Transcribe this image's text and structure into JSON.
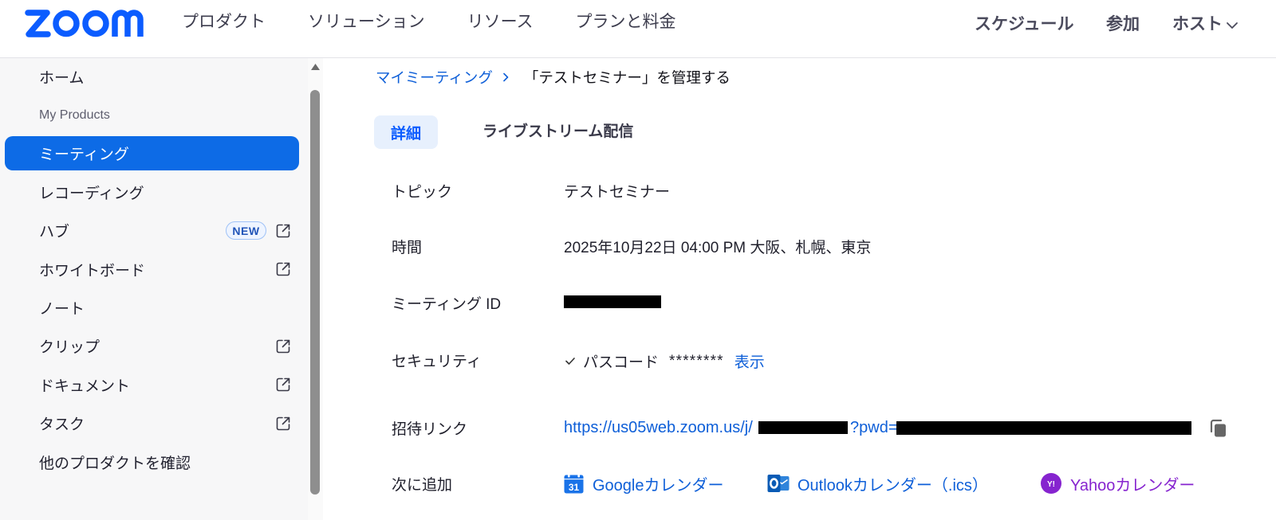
{
  "colors": {
    "brand": "#0b5cff",
    "accent": "#0d6be6",
    "link": "#0e5fd8",
    "yahoo_purple": "#8624cf",
    "sidebar_bg": "#f7f7f8",
    "tab_active_bg": "#e7f0fd",
    "text": "#222230",
    "nav_text": "#3d3d4e"
  },
  "header": {
    "logo_text": "zoom",
    "nav": [
      {
        "label": "プロダクト"
      },
      {
        "label": "ソリューション"
      },
      {
        "label": "リソース"
      },
      {
        "label": "プランと料金"
      }
    ],
    "actions": {
      "schedule": "スケジュール",
      "join": "参加",
      "host": "ホスト",
      "host_icon": "chevron-down-icon"
    }
  },
  "sidebar": {
    "items": [
      {
        "label": "ホーム"
      },
      {
        "label": "My Products",
        "section_header": true
      },
      {
        "label": "ミーティング",
        "selected": true
      },
      {
        "label": "レコーディング"
      },
      {
        "label": "ハブ",
        "badge": "NEW",
        "external": true,
        "icon": "external-link-icon"
      },
      {
        "label": "ホワイトボード",
        "external": true,
        "icon": "external-link-icon"
      },
      {
        "label": "ノート"
      },
      {
        "label": "クリップ",
        "external": true,
        "icon": "external-link-icon"
      },
      {
        "label": "ドキュメント",
        "external": true,
        "icon": "external-link-icon"
      },
      {
        "label": "タスク",
        "external": true,
        "icon": "external-link-icon"
      },
      {
        "label": "他のプロダクトを確認"
      }
    ]
  },
  "main": {
    "breadcrumb": {
      "parent": "マイミーティング",
      "separator_icon": "chevron-right-icon",
      "current": "「テストセミナー」を管理する"
    },
    "tabs": [
      {
        "label": "詳細",
        "active": true
      },
      {
        "label": "ライブストリーム配信",
        "active": false
      }
    ],
    "details": {
      "topic": {
        "label": "トピック",
        "value": "テストセミナー"
      },
      "time": {
        "label": "時間",
        "value": "2025年10月22日 04:00 PM 大阪、札幌、東京"
      },
      "meeting_id": {
        "label": "ミーティング ID",
        "value_redacted": true
      },
      "security": {
        "label": "セキュリティ",
        "check_icon": "checkmark-icon",
        "passcode_label": "パスコード",
        "passcode_masked": "********",
        "show_link": "表示"
      },
      "invite_link": {
        "label": "招待リンク",
        "url_prefix": "https://us05web.zoom.us/j/",
        "meeting_number_redacted": true,
        "pwd_param": "?pwd=",
        "password_redacted": true,
        "copy_icon": "copy-icon"
      },
      "add_to": {
        "label": "次に追加",
        "calendars": [
          {
            "label": "Googleカレンダー",
            "icon": "google-calendar-icon",
            "icon_glyph": "31"
          },
          {
            "label": "Outlookカレンダー（.ics）",
            "icon": "outlook-icon"
          },
          {
            "label": "Yahooカレンダー",
            "icon": "yahoo-icon",
            "icon_glyph": "Y!"
          }
        ]
      }
    }
  }
}
